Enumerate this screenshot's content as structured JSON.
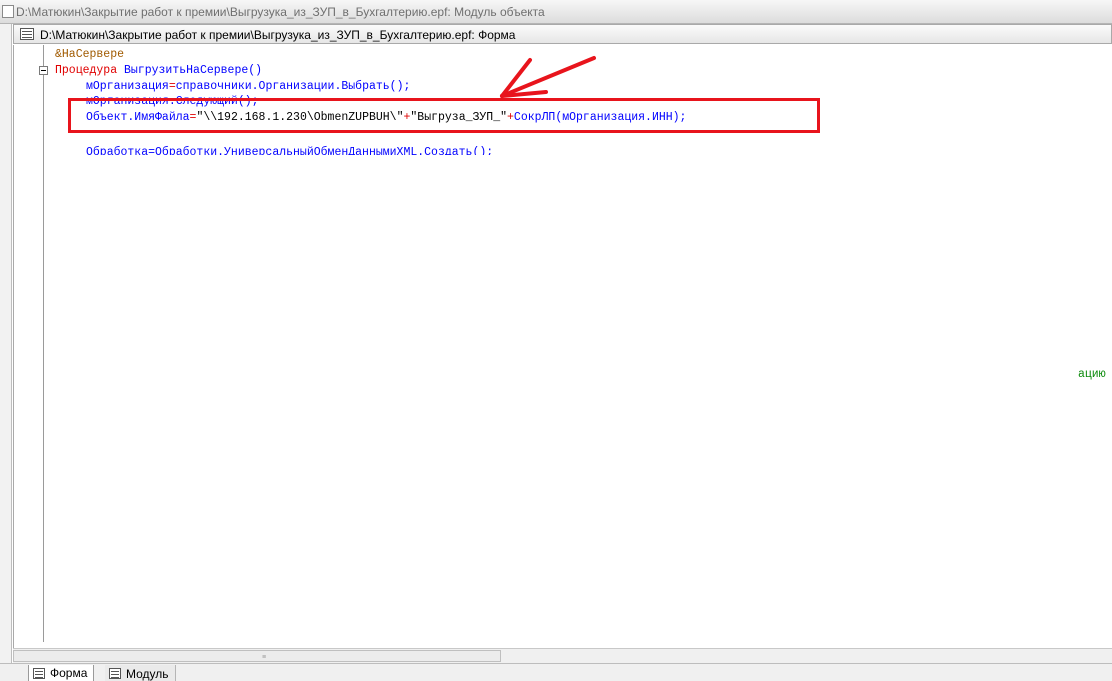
{
  "outer_window": {
    "title": "D:\\Матюкин\\Закрытие работ к премии\\Выгрузука_из_ЗУП_в_Бухгалтерию.epf: Модуль объекта"
  },
  "form_window": {
    "title": "D:\\Матюкин\\Закрытие работ к премии\\Выгрузука_из_ЗУП_в_Бухгалтерию.epf: Форма"
  },
  "code": {
    "line1": "&НаСервере",
    "line2_kw": "Процедура",
    "line2_name": " ВыгрузитьНаСервере()",
    "line3_a": "мОрганизация",
    "line3_b": "=",
    "line3_c": "справочники.Организации.Выбрать();",
    "line4": "мОрганизация.Следующий();",
    "line5_a": "Объект.ИмяФайла",
    "line5_b": "=",
    "line5_c": "\"\\\\192.168.1.230\\ObmenZUPBUH\\\"",
    "line5_d": "+",
    "line5_e": "\"Выгруза_ЗУП_\"",
    "line5_f": "+",
    "line5_g": "СокрЛП(мОрганизация.ИНН);",
    "line6": "Обработка=Обработки.УниверсальныйОбменДаннымиXML.Создать();"
  },
  "side_fragment": "ацию",
  "tabs": [
    {
      "label": "Форма",
      "active": true
    },
    {
      "label": "Модуль",
      "active": false
    }
  ],
  "colors": {
    "keyword": "#e00000",
    "identifier": "#0000ff",
    "highlight_box": "#e8141c",
    "annotation_arrow": "#e8141c"
  }
}
